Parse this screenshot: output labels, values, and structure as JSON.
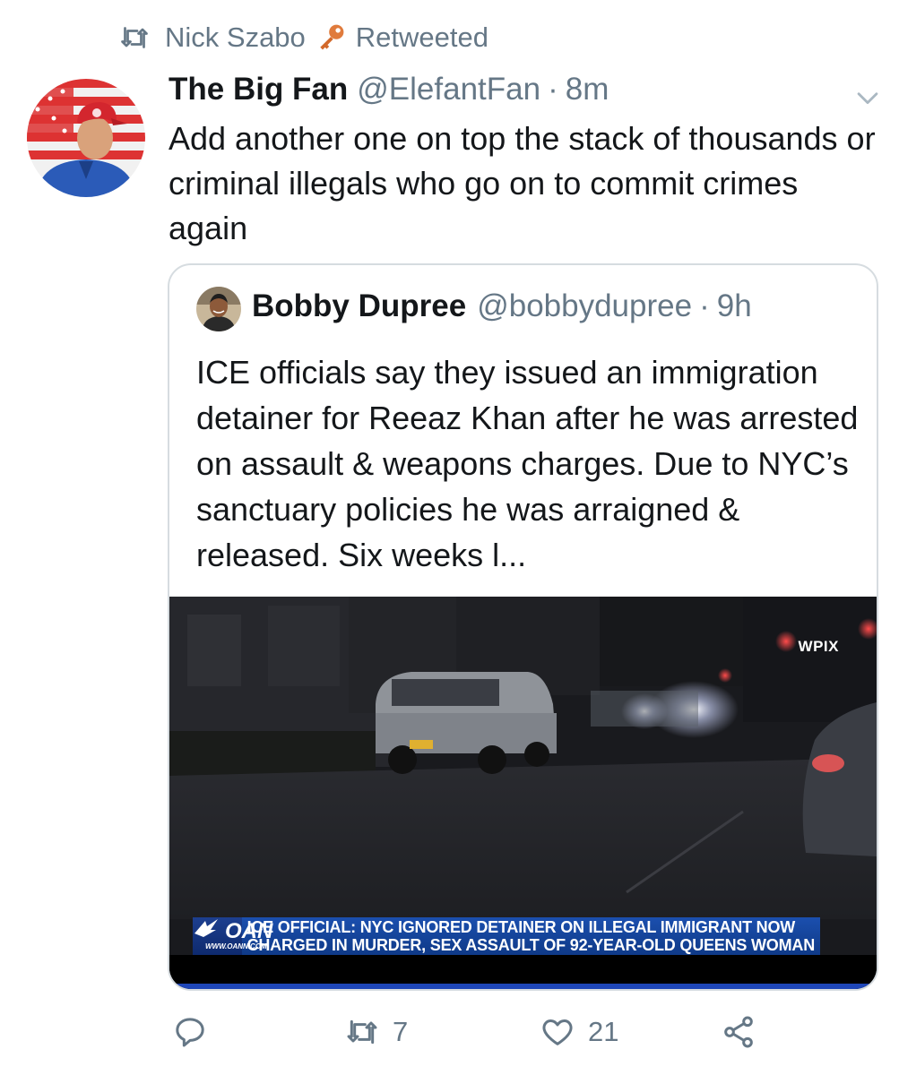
{
  "retweet": {
    "icon": "retweet-icon",
    "name": "Nick Szabo",
    "emoji_icon": "key-icon",
    "label": "Retweeted"
  },
  "tweet": {
    "display_name": "The Big Fan",
    "handle": "@ElefantFan",
    "separator": "·",
    "time": "8m",
    "text": "Add another one on top the stack of thousands or criminal illegals who go on to commit crimes again",
    "menu_icon": "chevron-down-icon"
  },
  "quoted": {
    "display_name": "Bobby Dupree",
    "handle": "@bobbydupree",
    "separator": "·",
    "time": "9h",
    "text": "ICE officials say they issued an immigration detainer for Reeaz Khan after he was arrested on assault & weapons charges. Due to NYC’s sanctuary policies he was arraigned & released. Six weeks l...",
    "media": {
      "watermark": "WPIX",
      "network_logo": "OAN",
      "network_url": "WWW.OANN.COM",
      "headline_line1": "ICE OFFICIAL: NYC IGNORED DETAINER ON ILLEGAL IMMIGRANT NOW",
      "headline_line2": "CHARGED IN MURDER, SEX ASSAULT OF 92-YEAR-OLD QUEENS WOMAN"
    }
  },
  "actions": {
    "reply_icon": "reply-icon",
    "retweet_icon": "retweet-icon",
    "retweet_count": "7",
    "like_icon": "heart-icon",
    "like_count": "21",
    "share_icon": "share-icon"
  },
  "colors": {
    "muted": "#657786",
    "text": "#14171a",
    "border": "#d6dce0",
    "key": "#e07b3c"
  }
}
